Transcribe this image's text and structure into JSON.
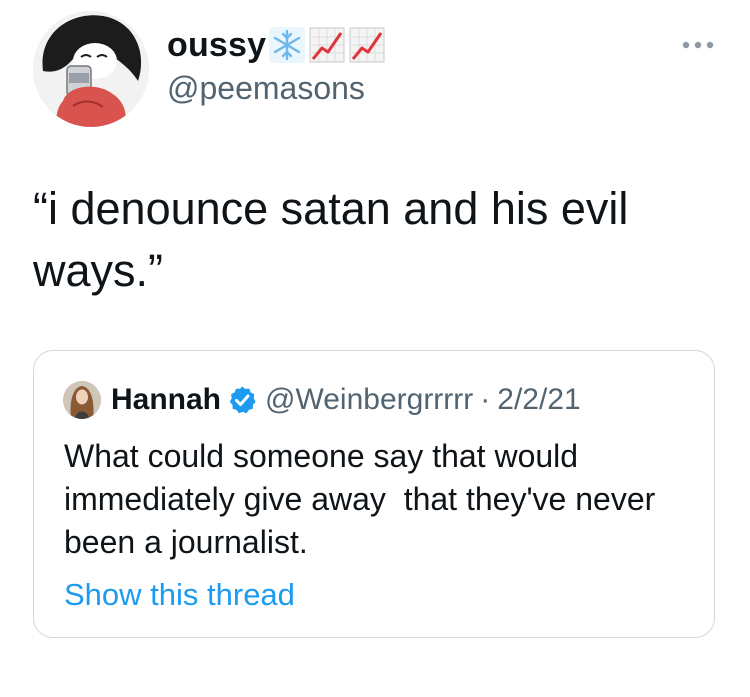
{
  "author": {
    "display_name": "oussy",
    "handle": "@peemasons",
    "name_emojis": [
      "snowflake-icon",
      "chart-increasing-icon",
      "chart-increasing-icon"
    ]
  },
  "tweet": {
    "text": "“i denounce satan and his evil ways.”"
  },
  "quoted_tweet": {
    "display_name": "Hannah",
    "handle": "@Weinbergrrrrr",
    "separator": "·",
    "date": "2/2/21",
    "text": "What could someone say that would immediately give away  that they've never been a journalist.",
    "show_thread_label": "Show this thread"
  },
  "colors": {
    "primary_text": "#0f1419",
    "secondary_text": "#536471",
    "link": "#1d9bf0",
    "border": "#cfd9de",
    "verified": "#1d9bf0"
  }
}
